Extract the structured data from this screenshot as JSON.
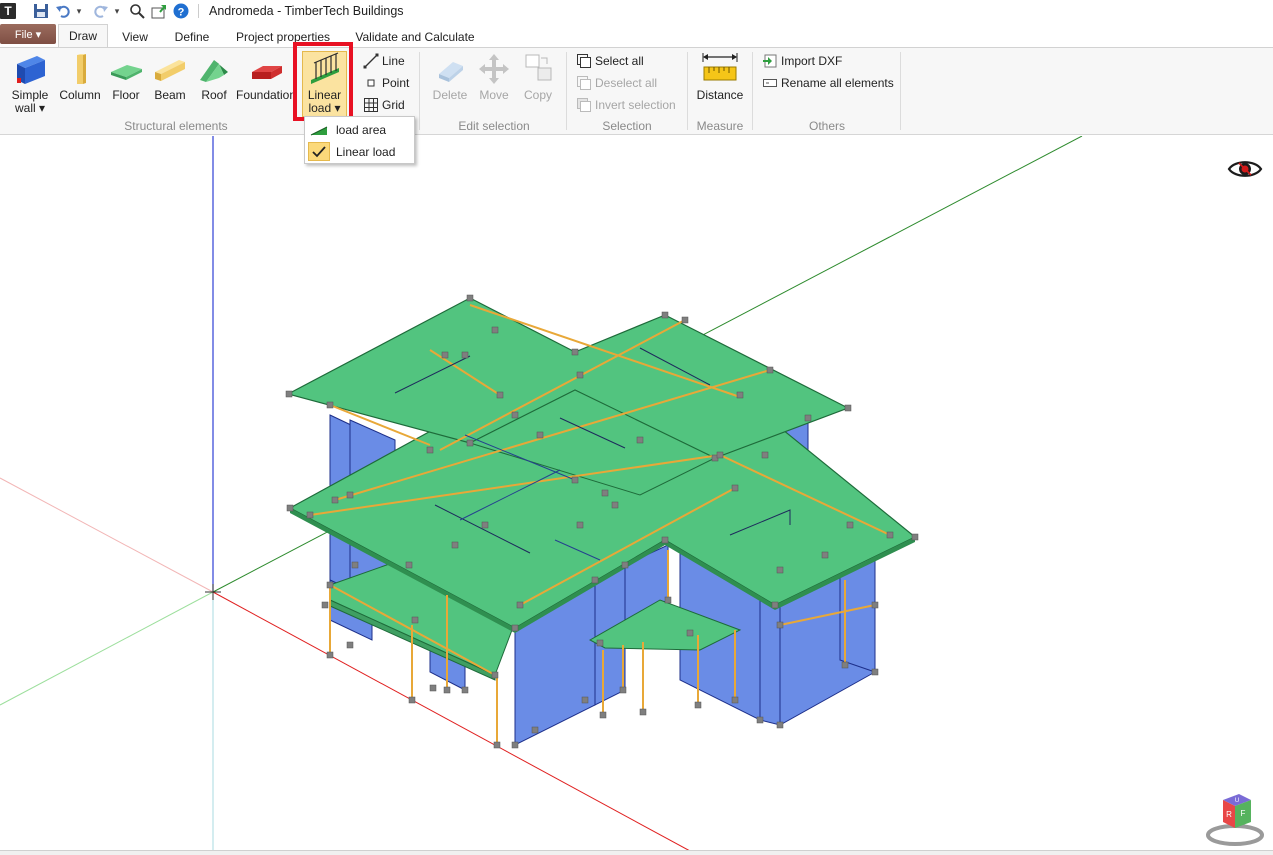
{
  "window": {
    "title": "Andromeda - TimberTech Buildings",
    "logo": "T"
  },
  "quick_access": [
    "save-icon",
    "undo-icon",
    "redo-icon",
    "zoom-icon",
    "export-icon",
    "help-icon"
  ],
  "file_menu": {
    "label": "File ▾"
  },
  "tabs": [
    {
      "label": "Draw",
      "active": true
    },
    {
      "label": "View",
      "active": false
    },
    {
      "label": "Define",
      "active": false
    },
    {
      "label": "Project properties",
      "active": false
    },
    {
      "label": "Validate and Calculate",
      "active": false
    }
  ],
  "ribbon": {
    "structural": {
      "group_label": "Structural elements",
      "simple_wall": "Simple wall ▾",
      "column": "Column",
      "floor": "Floor",
      "beam": "Beam",
      "roof": "Roof",
      "foundation": "Foundation",
      "linear_load": "Linear load ▾",
      "line": "Line",
      "point": "Point",
      "grid": "Grid"
    },
    "edit_selection": {
      "group_label": "Edit selection",
      "delete": "Delete",
      "move": "Move",
      "copy": "Copy"
    },
    "selection": {
      "group_label": "Selection",
      "select_all": "Select all",
      "deselect_all": "Deselect all",
      "invert": "Invert selection"
    },
    "measure": {
      "group_label": "Measure",
      "distance": "Distance"
    },
    "others": {
      "group_label": "Others",
      "import_dxf": "Import DXF",
      "rename_all": "Rename all elements"
    }
  },
  "dropdown": {
    "items": [
      {
        "label": "load area",
        "checked": false
      },
      {
        "label": "Linear load",
        "checked": true
      }
    ]
  },
  "colors": {
    "slab": "#52c47f",
    "wall": "#6a8ce6",
    "beam": "#e8a838",
    "axis_z": "#2f3fd6",
    "axis_x": "#e02020",
    "axis_y": "#2e8b2e",
    "highlight": "#e81123"
  },
  "viewport": {
    "hidden_elements_icon": "eye-slash-icon",
    "nav_cube": "view-cube-icon"
  }
}
